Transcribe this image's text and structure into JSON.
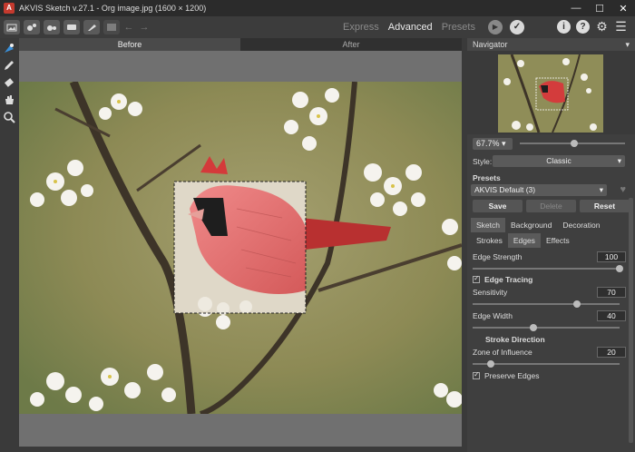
{
  "window": {
    "title": "AKVIS Sketch v.27.1 - Org image.jpg (1600 × 1200)",
    "logo": "AKVIS",
    "minimize": "—",
    "maximize": "☐",
    "close": "✕"
  },
  "toolbar": {
    "modes": [
      "Express",
      "Advanced",
      "Presets"
    ],
    "active_mode": "Advanced"
  },
  "canvas_tabs": {
    "before": "Before",
    "after": "After"
  },
  "navigator": {
    "title": "Navigator",
    "zoom": "67.7%",
    "zoom_level": 0.5
  },
  "style": {
    "label": "Style:",
    "value": "Classic"
  },
  "presets": {
    "label": "Presets",
    "value": "AKVIS Default (3)",
    "save": "Save",
    "delete": "Delete",
    "reset": "Reset"
  },
  "main_tabs": [
    "Sketch",
    "Background",
    "Decoration"
  ],
  "sub_tabs": [
    "Strokes",
    "Edges",
    "Effects"
  ],
  "params": {
    "edge_strength": {
      "label": "Edge Strength",
      "value": "100",
      "level": 1.0
    },
    "edge_tracing": {
      "label": "Edge Tracing"
    },
    "sensitivity": {
      "label": "Sensitivity",
      "value": "70",
      "level": 0.7
    },
    "edge_width": {
      "label": "Edge Width",
      "value": "40",
      "level": 0.4
    },
    "stroke_direction": {
      "label": "Stroke Direction"
    },
    "zone_of_influence": {
      "label": "Zone of Influence",
      "value": "20",
      "level": 0.1
    },
    "preserve_edges": {
      "label": "Preserve Edges"
    }
  },
  "colors": {
    "accent_red": "#e06a6a",
    "panel_bg": "#3f3f3f",
    "titlebar_bg": "#2b2b2b"
  }
}
